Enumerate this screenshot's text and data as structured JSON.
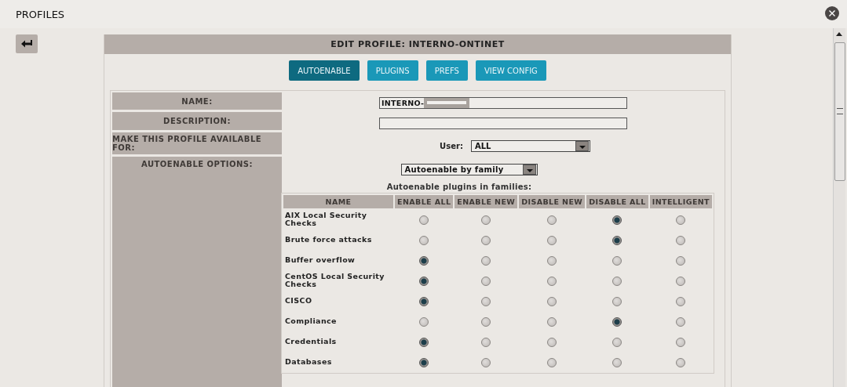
{
  "window": {
    "title": "PROFILES"
  },
  "panel_title": "EDIT PROFILE: INTERNO-ONTINET",
  "tabs": [
    {
      "label": "AUTOENABLE",
      "selected": true
    },
    {
      "label": "PLUGINS",
      "selected": false
    },
    {
      "label": "PREFS",
      "selected": false
    },
    {
      "label": "VIEW CONFIG",
      "selected": false
    }
  ],
  "form": {
    "name_label": "NAME:",
    "name_value": "INTERNO-",
    "description_label": "DESCRIPTION:",
    "available_label": "MAKE THIS PROFILE AVAILABLE FOR:",
    "user_label": "User:",
    "user_value": "ALL",
    "autoenable_label": "AUTOENABLE OPTIONS:",
    "autoenable_mode": "Autoenable by family",
    "families_caption": "Autoenable plugins in families:"
  },
  "table": {
    "columns": [
      "NAME",
      "ENABLE ALL",
      "ENABLE NEW",
      "DISABLE NEW",
      "DISABLE ALL",
      "INTELLIGENT"
    ],
    "rows": [
      {
        "name": "AIX Local Security Checks",
        "options": [
          {
            "selected": false
          },
          {
            "selected": false
          },
          {
            "selected": false
          },
          {
            "selected": true
          },
          {
            "selected": false
          }
        ]
      },
      {
        "name": "Brute force attacks",
        "options": [
          {
            "selected": false
          },
          {
            "selected": false
          },
          {
            "selected": false
          },
          {
            "selected": true
          },
          {
            "selected": false
          }
        ]
      },
      {
        "name": "Buffer overflow",
        "options": [
          {
            "selected": true
          },
          {
            "selected": false
          },
          {
            "selected": false
          },
          {
            "selected": false
          },
          {
            "selected": false
          }
        ]
      },
      {
        "name": "CentOS Local Security Checks",
        "options": [
          {
            "selected": true
          },
          {
            "selected": false
          },
          {
            "selected": false
          },
          {
            "selected": false
          },
          {
            "selected": false
          }
        ]
      },
      {
        "name": "CISCO",
        "options": [
          {
            "selected": true
          },
          {
            "selected": false
          },
          {
            "selected": false
          },
          {
            "selected": false
          },
          {
            "selected": false
          }
        ]
      },
      {
        "name": "Compliance",
        "options": [
          {
            "selected": false
          },
          {
            "selected": false
          },
          {
            "selected": false
          },
          {
            "selected": true
          },
          {
            "selected": false
          }
        ]
      },
      {
        "name": "Credentials",
        "options": [
          {
            "selected": true
          },
          {
            "selected": false
          },
          {
            "selected": false
          },
          {
            "selected": false
          },
          {
            "selected": false
          }
        ]
      },
      {
        "name": "Databases",
        "options": [
          {
            "selected": true
          },
          {
            "selected": false
          },
          {
            "selected": false
          },
          {
            "selected": false
          },
          {
            "selected": false
          }
        ]
      }
    ]
  }
}
